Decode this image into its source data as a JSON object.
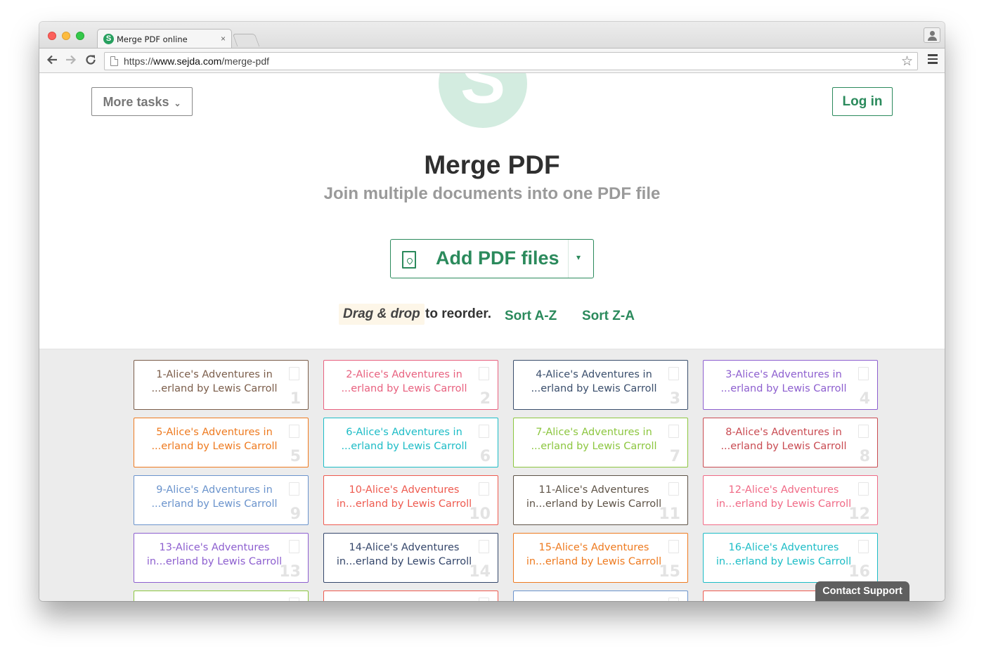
{
  "browser": {
    "tab_title": "Merge PDF online",
    "tab_close": "×",
    "favicon_letter": "S",
    "url_prefix": "https://",
    "url_host": "www.sejda.com",
    "url_path": "/merge-pdf",
    "back_icon": "arrow-left-icon",
    "forward_icon": "arrow-right-icon",
    "reload_icon": "reload-icon",
    "star_icon": "star-icon",
    "menu_icon": "hamburger-menu-icon"
  },
  "header": {
    "logo_letter": "S",
    "more_tasks_label": "More tasks",
    "more_tasks_caret": "⌄",
    "login_label": "Log in"
  },
  "hero": {
    "title": "Merge PDF",
    "subtitle": "Join multiple documents into one PDF file",
    "add_button_label": "Add PDF files",
    "add_button_dropdown": "▾"
  },
  "reorder": {
    "drag_hint": "Drag & drop",
    "drag_text": "to reorder.",
    "sort_az": "Sort A-Z",
    "sort_za": "Sort Z-A"
  },
  "files": [
    {
      "line1": "1-Alice's Adventures in",
      "line2": "...erland by Lewis Carroll",
      "num": "1",
      "color": "#7b5d4a"
    },
    {
      "line1": "2-Alice's Adventures in",
      "line2": "...erland by Lewis Carroll",
      "num": "2",
      "color": "#e8617f"
    },
    {
      "line1": "4-Alice's Adventures in",
      "line2": "...erland by Lewis Carroll",
      "num": "3",
      "color": "#3a4e6c"
    },
    {
      "line1": "3-Alice's Adventures in",
      "line2": "...erland by Lewis Carroll",
      "num": "4",
      "color": "#8d5fcf"
    },
    {
      "line1": "5-Alice's Adventures in",
      "line2": "...erland by Lewis Carroll",
      "num": "5",
      "color": "#ee7a1f"
    },
    {
      "line1": "6-Alice's Adventures in",
      "line2": "...erland by Lewis Carroll",
      "num": "6",
      "color": "#1cbcc6"
    },
    {
      "line1": "7-Alice's Adventures in",
      "line2": "...erland by Lewis Carroll",
      "num": "7",
      "color": "#8cc63f"
    },
    {
      "line1": "8-Alice's Adventures in",
      "line2": "...erland by Lewis Carroll",
      "num": "8",
      "color": "#c94b52"
    },
    {
      "line1": "9-Alice's Adventures in",
      "line2": "...erland by Lewis Carroll",
      "num": "9",
      "color": "#6a93cc"
    },
    {
      "line1": "10-Alice's Adventures",
      "line2": "in...erland by Lewis Carroll",
      "num": "10",
      "color": "#ee5a4f"
    },
    {
      "line1": "11-Alice's Adventures",
      "line2": "in...erland by Lewis Carroll",
      "num": "11",
      "color": "#5e5347"
    },
    {
      "line1": "12-Alice's Adventures",
      "line2": "in...erland by Lewis Carroll",
      "num": "12",
      "color": "#f06a86"
    },
    {
      "line1": "13-Alice's Adventures",
      "line2": "in...erland by Lewis Carroll",
      "num": "13",
      "color": "#8d5fcf"
    },
    {
      "line1": "14-Alice's Adventures",
      "line2": "in...erland by Lewis Carroll",
      "num": "14",
      "color": "#34466a"
    },
    {
      "line1": "15-Alice's Adventures",
      "line2": "in...erland by Lewis Carroll",
      "num": "15",
      "color": "#ee7a1f"
    },
    {
      "line1": "16-Alice's Adventures",
      "line2": "in...erland by Lewis Carroll",
      "num": "16",
      "color": "#1cbcc6"
    },
    {
      "line1": "",
      "line2": "",
      "num": "",
      "color": "#8cc63f"
    },
    {
      "line1": "",
      "line2": "",
      "num": "",
      "color": "#ee5a4f"
    },
    {
      "line1": "",
      "line2": "",
      "num": "",
      "color": "#6a93cc"
    },
    {
      "line1": "",
      "line2": "",
      "num": "",
      "color": "#ee5a4f"
    }
  ],
  "support": {
    "label": "Contact Support"
  },
  "colors": {
    "brand_green": "#2b8a5c",
    "logo_green_light": "#d3ece0",
    "files_background": "#ececec",
    "support_bg": "#5f5f5f"
  }
}
